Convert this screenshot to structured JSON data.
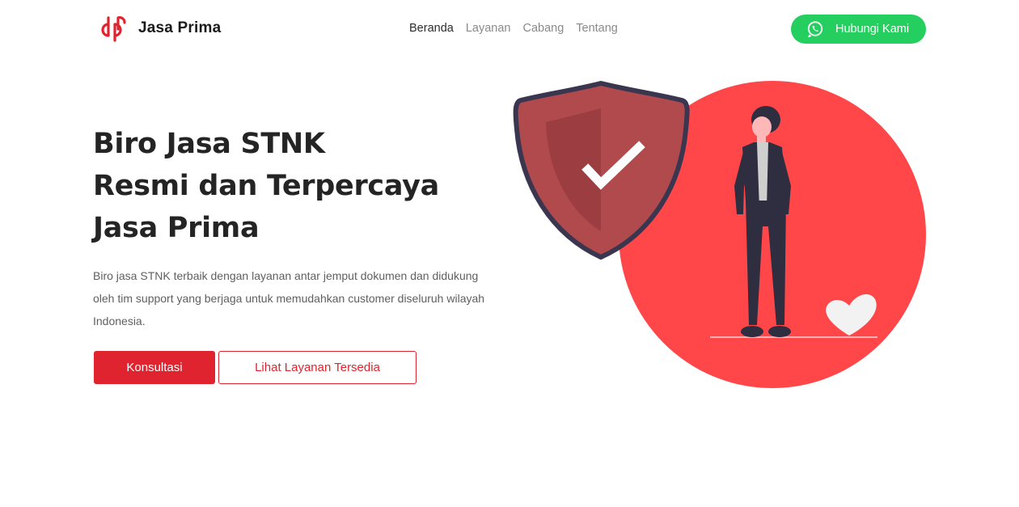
{
  "brand": {
    "name": "Jasa Prima",
    "color": "#e0242f"
  },
  "nav": {
    "items": [
      {
        "label": "Beranda",
        "active": true
      },
      {
        "label": "Layanan",
        "active": false
      },
      {
        "label": "Cabang",
        "active": false
      },
      {
        "label": "Tentang",
        "active": false
      }
    ],
    "cta_label": "Hubungi Kami",
    "cta_icon": "whatsapp-icon",
    "cta_color": "#25cf5f"
  },
  "hero": {
    "title_lines": [
      "Biro Jasa STNK",
      "Resmi dan Terpercaya",
      "Jasa Prima"
    ],
    "description": "Biro jasa STNK terbaik dengan layanan antar jemput dokumen dan didukung oleh tim support yang berjaga untuk memudahkan customer diseluruh wilayah Indonesia.",
    "primary_button": "Konsultasi",
    "secondary_button": "Lihat Layanan Tersedia"
  },
  "illustration": {
    "icons": [
      "shield-check-icon",
      "person-figure",
      "heart-icon"
    ],
    "circle_color": "#ff474a",
    "shield_color": "#b04a4d"
  }
}
